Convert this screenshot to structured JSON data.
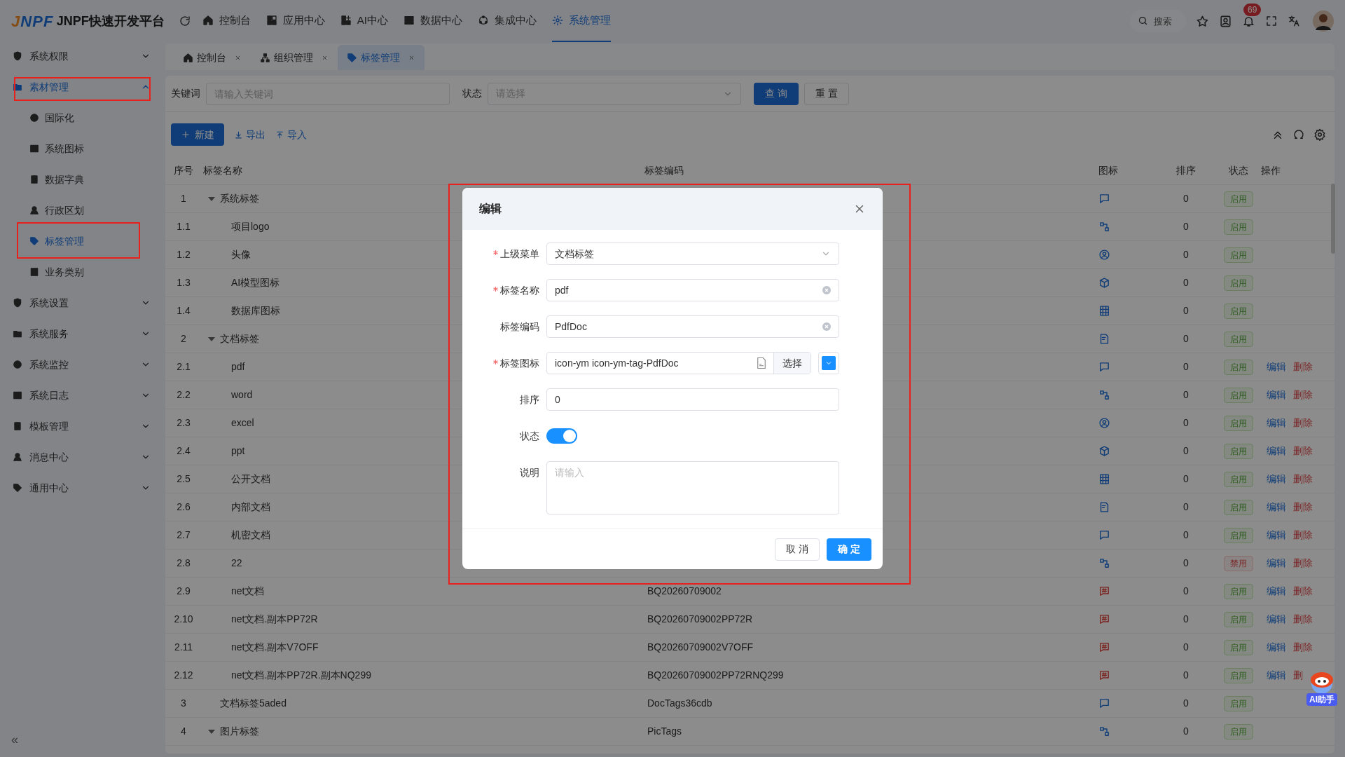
{
  "header": {
    "logo": "JNPF",
    "title": "JNPF快速开发平台",
    "nav": [
      {
        "label": "控制台",
        "selected": false
      },
      {
        "label": "应用中心",
        "selected": false
      },
      {
        "label": "AI中心",
        "selected": false
      },
      {
        "label": "数据中心",
        "selected": false
      },
      {
        "label": "集成中心",
        "selected": false
      },
      {
        "label": "系统管理",
        "selected": true
      }
    ],
    "search_placeholder": "搜索",
    "notifications": "69"
  },
  "sidebar": {
    "items": [
      {
        "label": "系统权限",
        "expanded": false,
        "selected": false,
        "highlighted": false
      },
      {
        "label": "素材管理",
        "expanded": true,
        "selected": true,
        "highlighted": true,
        "children": [
          {
            "label": "国际化",
            "selected": false,
            "highlighted": false
          },
          {
            "label": "系统图标",
            "selected": false,
            "highlighted": false
          },
          {
            "label": "数据字典",
            "selected": false,
            "highlighted": false
          },
          {
            "label": "行政区划",
            "selected": false,
            "highlighted": false
          },
          {
            "label": "标签管理",
            "selected": true,
            "highlighted": true
          },
          {
            "label": "业务类别",
            "selected": false,
            "highlighted": false
          }
        ]
      },
      {
        "label": "系统设置",
        "expanded": false,
        "selected": false,
        "highlighted": false
      },
      {
        "label": "系统服务",
        "expanded": false,
        "selected": false,
        "highlighted": false
      },
      {
        "label": "系统监控",
        "expanded": false,
        "selected": false,
        "highlighted": false
      },
      {
        "label": "系统日志",
        "expanded": false,
        "selected": false,
        "highlighted": false
      },
      {
        "label": "模板管理",
        "expanded": false,
        "selected": false,
        "highlighted": false
      },
      {
        "label": "消息中心",
        "expanded": false,
        "selected": false,
        "highlighted": false
      },
      {
        "label": "通用中心",
        "expanded": false,
        "selected": false,
        "highlighted": false
      }
    ],
    "collapse": "«"
  },
  "tabs": [
    {
      "label": "控制台",
      "selected": false
    },
    {
      "label": "组织管理",
      "selected": false
    },
    {
      "label": "标签管理",
      "selected": true
    }
  ],
  "filters": {
    "keyword_label": "关键词",
    "keyword_placeholder": "请输入关键词",
    "status_label": "状态",
    "status_placeholder": "请选择",
    "query": "查 询",
    "reset": "重 置"
  },
  "toolbar": {
    "new": "新建",
    "export": "导出",
    "import": "导入"
  },
  "table": {
    "columns": [
      "序号",
      "标签名称",
      "标签编码",
      "图标",
      "排序",
      "状态",
      "操作"
    ],
    "rows": [
      {
        "index": "1",
        "name": "系统标签",
        "expanded": true,
        "sort": "0",
        "status": "启用",
        "enabled": true,
        "kind": "doc",
        "children": [
          {
            "index": "1.1",
            "name": "项目logo",
            "sort": "0",
            "status": "启用",
            "enabled": true,
            "kind": "doc"
          },
          {
            "index": "1.2",
            "name": "头像",
            "sort": "0",
            "status": "启用",
            "enabled": true,
            "kind": "doc"
          },
          {
            "index": "1.3",
            "name": "AI模型图标",
            "sort": "0",
            "status": "启用",
            "enabled": true,
            "kind": "doc"
          },
          {
            "index": "1.4",
            "name": "数据库图标",
            "sort": "0",
            "status": "启用",
            "enabled": true,
            "kind": "doc"
          }
        ]
      },
      {
        "index": "2",
        "name": "文档标签",
        "expanded": true,
        "sort": "0",
        "status": "启用",
        "enabled": true,
        "kind": "doc",
        "children": [
          {
            "index": "2.1",
            "name": "pdf",
            "sort": "0",
            "status": "启用",
            "enabled": true,
            "kind": "doc",
            "actions": [
              {
                "label": "编辑",
                "kind": "edit"
              },
              {
                "label": "删除",
                "kind": "delete"
              }
            ]
          },
          {
            "index": "2.2",
            "name": "word",
            "sort": "0",
            "status": "启用",
            "enabled": true,
            "kind": "doc",
            "actions": [
              {
                "label": "编辑",
                "kind": "edit"
              },
              {
                "label": "删除",
                "kind": "delete"
              }
            ]
          },
          {
            "index": "2.3",
            "name": "excel",
            "sort": "0",
            "status": "启用",
            "enabled": true,
            "kind": "doc",
            "actions": [
              {
                "label": "编辑",
                "kind": "edit"
              },
              {
                "label": "删除",
                "kind": "delete"
              }
            ]
          },
          {
            "index": "2.4",
            "name": "ppt",
            "sort": "0",
            "status": "启用",
            "enabled": true,
            "kind": "doc",
            "actions": [
              {
                "label": "编辑",
                "kind": "edit"
              },
              {
                "label": "删除",
                "kind": "delete"
              }
            ]
          },
          {
            "index": "2.5",
            "name": "公开文档",
            "sort": "0",
            "status": "启用",
            "enabled": true,
            "kind": "doc",
            "actions": [
              {
                "label": "编辑",
                "kind": "edit"
              },
              {
                "label": "删除",
                "kind": "delete"
              }
            ]
          },
          {
            "index": "2.6",
            "name": "内部文档",
            "sort": "0",
            "status": "启用",
            "enabled": true,
            "kind": "doc",
            "actions": [
              {
                "label": "编辑",
                "kind": "edit"
              },
              {
                "label": "删除",
                "kind": "delete"
              }
            ]
          },
          {
            "index": "2.7",
            "name": "机密文档",
            "sort": "0",
            "status": "启用",
            "enabled": true,
            "kind": "doc",
            "actions": [
              {
                "label": "编辑",
                "kind": "edit"
              },
              {
                "label": "删除",
                "kind": "delete"
              }
            ]
          },
          {
            "index": "2.8",
            "name": "22",
            "sort": "0",
            "status": "禁用",
            "enabled": false,
            "kind": "doc",
            "actions": [
              {
                "label": "编辑",
                "kind": "edit"
              },
              {
                "label": "删除",
                "kind": "delete"
              }
            ]
          },
          {
            "index": "2.9",
            "name": "net文档",
            "code": "BQ20260709002",
            "sort": "0",
            "status": "启用",
            "enabled": true,
            "kind": "hash",
            "actions": [
              {
                "label": "编辑",
                "kind": "edit"
              },
              {
                "label": "删除",
                "kind": "delete"
              }
            ]
          },
          {
            "index": "2.10",
            "name": "net文档.副本PP72R",
            "code": "BQ20260709002PP72R",
            "sort": "0",
            "status": "启用",
            "enabled": true,
            "kind": "hash",
            "actions": [
              {
                "label": "编辑",
                "kind": "edit"
              },
              {
                "label": "删除",
                "kind": "delete"
              }
            ]
          },
          {
            "index": "2.11",
            "name": "net文档.副本V7OFF",
            "code": "BQ20260709002V7OFF",
            "sort": "0",
            "status": "启用",
            "enabled": true,
            "kind": "hash",
            "actions": [
              {
                "label": "编辑",
                "kind": "edit"
              },
              {
                "label": "删除",
                "kind": "delete"
              }
            ]
          },
          {
            "index": "2.12",
            "name": "net文档.副本PP72R.副本NQ299",
            "code": "BQ20260709002PP72RNQ299",
            "sort": "0",
            "status": "启用",
            "enabled": true,
            "kind": "hash",
            "actions": [
              {
                "label": "编辑",
                "kind": "edit"
              },
              {
                "label": "删",
                "kind": "delete"
              }
            ]
          }
        ]
      },
      {
        "index": "3",
        "name": "文档标签5aded",
        "code": "DocTags36cdb",
        "sort": "0",
        "status": "启用",
        "enabled": true,
        "kind": "doc"
      },
      {
        "index": "4",
        "name": "图片标签",
        "expanded": true,
        "code": "PicTags",
        "sort": "0",
        "status": "启用",
        "enabled": true,
        "kind": "doc"
      }
    ]
  },
  "dialog": {
    "title": "编辑",
    "highlighted": true,
    "fields": [
      {
        "kind": "select",
        "label": "上级菜单",
        "required": true,
        "value": "文档标签"
      },
      {
        "kind": "text",
        "label": "标签名称",
        "required": true,
        "value": "pdf"
      },
      {
        "kind": "text",
        "label": "标签编码",
        "required": false,
        "value": "PdfDoc"
      },
      {
        "kind": "icon",
        "label": "标签图标",
        "required": true,
        "value": "icon-ym icon-ym-tag-PdfDoc",
        "button": "选择",
        "color": "#1890ff"
      },
      {
        "kind": "number",
        "label": "排序",
        "required": false,
        "value": "0"
      },
      {
        "kind": "switch",
        "label": "状态",
        "required": false,
        "on": true
      },
      {
        "kind": "textarea",
        "label": "说明",
        "required": false,
        "placeholder": "请输入"
      }
    ],
    "cancel": "取 消",
    "confirm": "确 定"
  },
  "assistant": {
    "label": "AI助手"
  }
}
